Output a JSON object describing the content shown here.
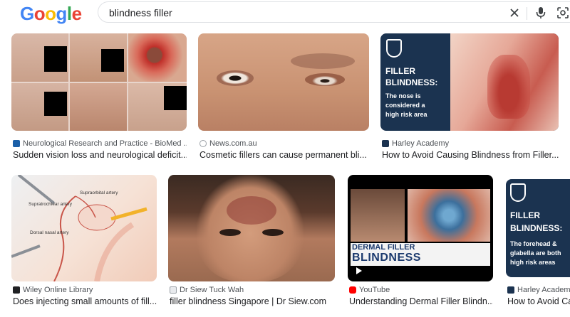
{
  "search": {
    "logo": "Google",
    "query": "blindness filler"
  },
  "colors": {
    "logo_blue": "#4285F4",
    "logo_red": "#EA4335",
    "logo_yellow": "#FBBC05",
    "logo_green": "#34A853",
    "harley_navy": "#1b3350"
  },
  "icons": {
    "clear": "close-icon",
    "voice": "microphone-icon",
    "lens": "camera-lens-icon"
  },
  "results": [
    {
      "source": "Neurological Research and Practice - BioMed ...",
      "title": "Sudden vision loss and neurological deficit...",
      "favicon": "biomed-icon"
    },
    {
      "source": "News.com.au",
      "title": "Cosmetic fillers can cause permanent bli...",
      "favicon": "news-icon"
    },
    {
      "source": "Harley Academy",
      "title": "How to Avoid Causing Blindness from Filler...",
      "favicon": "harley-icon",
      "overlay": {
        "heading1": "FILLER",
        "heading2": "BLINDNESS:",
        "body1": "The nose is",
        "body2": "considered a",
        "body3": "high risk area"
      }
    },
    {
      "source": "Wiley Online Library",
      "title": "Does injecting small amounts of fill...",
      "favicon": "wiley-icon",
      "labels": {
        "a": "Supraorbital artery",
        "b": "Supratrochlear artery",
        "c": "Dorsal nasal artery"
      }
    },
    {
      "source": "Dr Siew Tuck Wah",
      "title": "filler blindness Singapore | Dr Siew.com",
      "favicon": "doctor-icon"
    },
    {
      "source": "YouTube",
      "title": "Understanding Dermal Filler Blindn...",
      "favicon": "youtube-icon",
      "overlay": {
        "line1": "DERMAL FILLER",
        "line2": "BLINDNESS"
      }
    },
    {
      "source": "Harley Academy",
      "title": "How to Avoid Ca",
      "favicon": "harley-icon",
      "overlay": {
        "heading1": "FILLER",
        "heading2": "BLINDNESS:",
        "body1": "The forehead &",
        "body2": "glabella are both",
        "body3": "high risk areas"
      }
    }
  ]
}
